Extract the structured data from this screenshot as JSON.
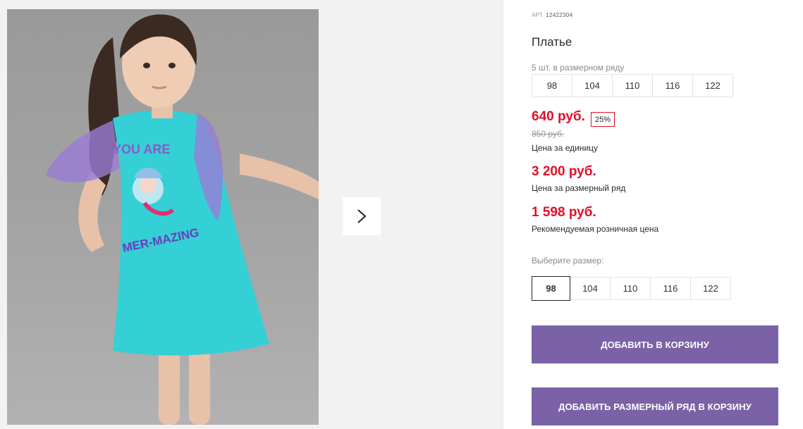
{
  "product": {
    "art_label": "АРТ.",
    "art_number": "12422304",
    "title": "Платье",
    "pack_note": "5 шт. в размерном ряду",
    "pack_sizes": [
      "98",
      "104",
      "110",
      "116",
      "122"
    ]
  },
  "prices": {
    "unit_price": "640 руб.",
    "discount": "25%",
    "old_price": "850 руб.",
    "unit_label": "Цена за единицу",
    "row_price": "3 200 руб.",
    "row_label": "Цена за размерный ряд",
    "retail_price": "1 598 руб.",
    "retail_label": "Рекомендуемая розничная цена"
  },
  "size_picker": {
    "label": "Выберите размер:",
    "options": [
      "98",
      "104",
      "110",
      "116",
      "122"
    ],
    "selected": "98"
  },
  "actions": {
    "add_to_cart": "ДОБАВИТЬ В КОРЗИНУ",
    "add_row_to_cart": "ДОБАВИТЬ РАЗМЕРНЫЙ РЯД В КОРЗИНУ"
  },
  "gallery": {
    "next_icon": "chevron-right-icon",
    "shirt_print_top": "YOU ARE",
    "shirt_print_bottom": "MER-MAZING"
  },
  "colors": {
    "price_red": "#e0102a",
    "button_purple": "#7b62a6",
    "dress_turquoise": "#35cfd6"
  }
}
